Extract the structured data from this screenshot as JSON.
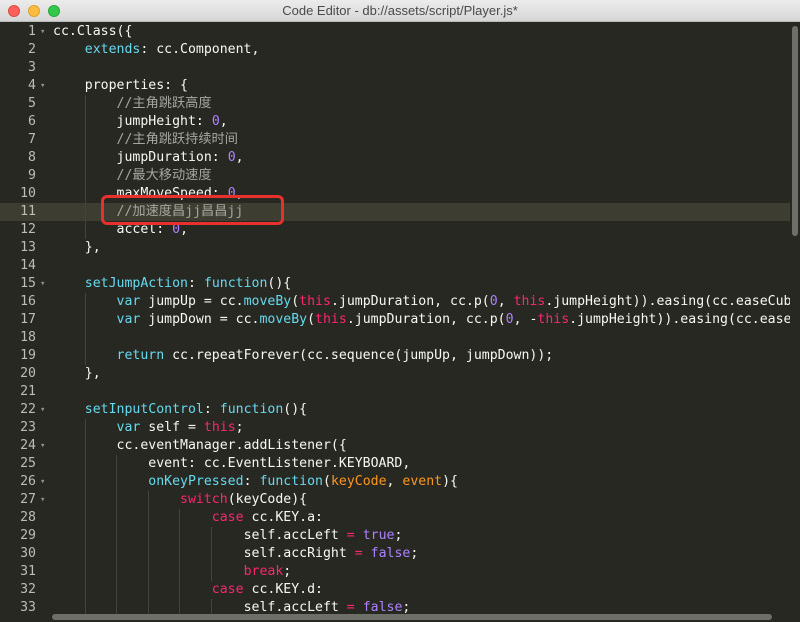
{
  "window": {
    "title": "Code Editor - db://assets/script/Player.js*"
  },
  "editor": {
    "language": "javascript",
    "active_line": 11,
    "lines": [
      {
        "n": "1",
        "fold": "▾",
        "indent": 0,
        "tokens": [
          [
            "t",
            "cc.Class({"
          ]
        ]
      },
      {
        "n": "2",
        "fold": "",
        "indent": 1,
        "tokens": [
          [
            "k",
            "extends"
          ],
          [
            "t",
            ": cc.Component,"
          ]
        ]
      },
      {
        "n": "3",
        "fold": "",
        "indent": 1,
        "tokens": []
      },
      {
        "n": "4",
        "fold": "▾",
        "indent": 1,
        "tokens": [
          [
            "t",
            "properties: {"
          ]
        ]
      },
      {
        "n": "5",
        "fold": "",
        "indent": 2,
        "tokens": [
          [
            "c",
            "//主角跳跃高度"
          ]
        ]
      },
      {
        "n": "6",
        "fold": "",
        "indent": 2,
        "tokens": [
          [
            "t",
            "jumpHeight: "
          ],
          [
            "n",
            "0"
          ],
          [
            "t",
            ","
          ]
        ]
      },
      {
        "n": "7",
        "fold": "",
        "indent": 2,
        "tokens": [
          [
            "c",
            "//主角跳跃持续时间"
          ]
        ]
      },
      {
        "n": "8",
        "fold": "",
        "indent": 2,
        "tokens": [
          [
            "t",
            "jumpDuration: "
          ],
          [
            "n",
            "0"
          ],
          [
            "t",
            ","
          ]
        ]
      },
      {
        "n": "9",
        "fold": "",
        "indent": 2,
        "tokens": [
          [
            "c",
            "//最大移动速度"
          ]
        ]
      },
      {
        "n": "10",
        "fold": "",
        "indent": 2,
        "tokens": [
          [
            "t",
            "maxMoveSpeed: "
          ],
          [
            "n",
            "0"
          ],
          [
            "t",
            ","
          ]
        ]
      },
      {
        "n": "11",
        "fold": "",
        "indent": 2,
        "tokens": [
          [
            "c",
            "//加速度昌jj昌昌jj"
          ]
        ]
      },
      {
        "n": "12",
        "fold": "",
        "indent": 2,
        "tokens": [
          [
            "t",
            "accel: "
          ],
          [
            "n",
            "0"
          ],
          [
            "t",
            ","
          ]
        ]
      },
      {
        "n": "13",
        "fold": "",
        "indent": 1,
        "tokens": [
          [
            "t",
            "},"
          ]
        ]
      },
      {
        "n": "14",
        "fold": "",
        "indent": 1,
        "tokens": []
      },
      {
        "n": "15",
        "fold": "▾",
        "indent": 1,
        "tokens": [
          [
            "f",
            "setJumpAction"
          ],
          [
            "t",
            ": "
          ],
          [
            "k",
            "function"
          ],
          [
            "t",
            "(){"
          ]
        ]
      },
      {
        "n": "16",
        "fold": "",
        "indent": 2,
        "tokens": [
          [
            "k",
            "var"
          ],
          [
            "t",
            " jumpUp = cc."
          ],
          [
            "f",
            "moveBy"
          ],
          [
            "t",
            "("
          ],
          [
            "r",
            "this"
          ],
          [
            "t",
            ".jumpDuration, cc.p("
          ],
          [
            "n",
            "0"
          ],
          [
            "t",
            ", "
          ],
          [
            "r",
            "this"
          ],
          [
            "t",
            ".jumpHeight)).easing(cc.easeCubicA"
          ]
        ]
      },
      {
        "n": "17",
        "fold": "",
        "indent": 2,
        "tokens": [
          [
            "k",
            "var"
          ],
          [
            "t",
            " jumpDown = cc."
          ],
          [
            "f",
            "moveBy"
          ],
          [
            "t",
            "("
          ],
          [
            "r",
            "this"
          ],
          [
            "t",
            ".jumpDuration, cc.p("
          ],
          [
            "n",
            "0"
          ],
          [
            "t",
            ", -"
          ],
          [
            "r",
            "this"
          ],
          [
            "t",
            ".jumpHeight)).easing(cc.easeCub"
          ]
        ]
      },
      {
        "n": "18",
        "fold": "",
        "indent": 2,
        "tokens": []
      },
      {
        "n": "19",
        "fold": "",
        "indent": 2,
        "tokens": [
          [
            "k",
            "return"
          ],
          [
            "t",
            " cc.repeatForever(cc.sequence(jumpUp, jumpDown));"
          ]
        ]
      },
      {
        "n": "20",
        "fold": "",
        "indent": 1,
        "tokens": [
          [
            "t",
            "},"
          ]
        ]
      },
      {
        "n": "21",
        "fold": "",
        "indent": 1,
        "tokens": []
      },
      {
        "n": "22",
        "fold": "▾",
        "indent": 1,
        "tokens": [
          [
            "f",
            "setInputControl"
          ],
          [
            "t",
            ": "
          ],
          [
            "k",
            "function"
          ],
          [
            "t",
            "(){"
          ]
        ]
      },
      {
        "n": "23",
        "fold": "",
        "indent": 2,
        "tokens": [
          [
            "k",
            "var"
          ],
          [
            "t",
            " self = "
          ],
          [
            "r",
            "this"
          ],
          [
            "t",
            ";"
          ]
        ]
      },
      {
        "n": "24",
        "fold": "▾",
        "indent": 2,
        "tokens": [
          [
            "t",
            "cc.eventManager.addListener({"
          ]
        ]
      },
      {
        "n": "25",
        "fold": "",
        "indent": 3,
        "tokens": [
          [
            "t",
            "event: cc.EventListener.KEYBOARD,"
          ]
        ]
      },
      {
        "n": "26",
        "fold": "▾",
        "indent": 3,
        "tokens": [
          [
            "f",
            "onKeyPressed"
          ],
          [
            "t",
            ": "
          ],
          [
            "k",
            "function"
          ],
          [
            "t",
            "("
          ],
          [
            "p",
            "keyCode"
          ],
          [
            "t",
            ", "
          ],
          [
            "p",
            "event"
          ],
          [
            "t",
            "){"
          ]
        ]
      },
      {
        "n": "27",
        "fold": "▾",
        "indent": 4,
        "tokens": [
          [
            "r",
            "switch"
          ],
          [
            "t",
            "(keyCode){"
          ]
        ]
      },
      {
        "n": "28",
        "fold": "",
        "indent": 5,
        "tokens": [
          [
            "r",
            "case"
          ],
          [
            "t",
            " cc.KEY.a:"
          ]
        ]
      },
      {
        "n": "29",
        "fold": "",
        "indent": 6,
        "tokens": [
          [
            "t",
            "self.accLeft "
          ],
          [
            "r",
            "="
          ],
          [
            "t",
            " "
          ],
          [
            "n",
            "true"
          ],
          [
            "t",
            ";"
          ]
        ]
      },
      {
        "n": "30",
        "fold": "",
        "indent": 6,
        "tokens": [
          [
            "t",
            "self.accRight "
          ],
          [
            "r",
            "="
          ],
          [
            "t",
            " "
          ],
          [
            "n",
            "false"
          ],
          [
            "t",
            ";"
          ]
        ]
      },
      {
        "n": "31",
        "fold": "",
        "indent": 6,
        "tokens": [
          [
            "r",
            "break"
          ],
          [
            "t",
            ";"
          ]
        ]
      },
      {
        "n": "32",
        "fold": "",
        "indent": 5,
        "tokens": [
          [
            "r",
            "case"
          ],
          [
            "t",
            " cc.KEY.d:"
          ]
        ]
      },
      {
        "n": "33",
        "fold": "",
        "indent": 6,
        "tokens": [
          [
            "t",
            "self.accLeft "
          ],
          [
            "r",
            "="
          ],
          [
            "t",
            " "
          ],
          [
            "n",
            "false"
          ],
          [
            "t",
            ";"
          ]
        ]
      }
    ]
  },
  "colors": {
    "background": "#272822",
    "highlight_box": "#e8312d"
  }
}
